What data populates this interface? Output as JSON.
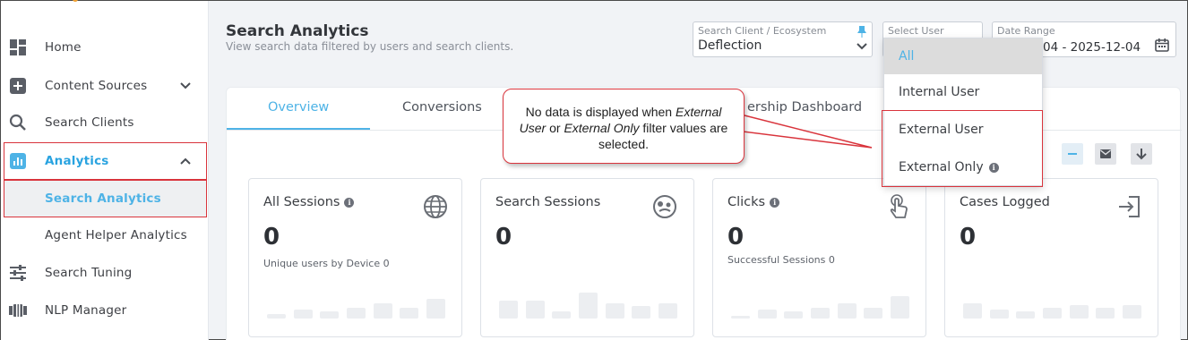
{
  "sidebar": {
    "items": [
      {
        "label": "Home",
        "icon": "dashboard-icon"
      },
      {
        "label": "Content Sources",
        "icon": "plus-box-icon"
      },
      {
        "label": "Search Clients",
        "icon": "search-icon"
      },
      {
        "label": "Analytics",
        "icon": "bar-chart-icon"
      },
      {
        "label": "Search Analytics"
      },
      {
        "label": "Agent Helper Analytics"
      },
      {
        "label": "Search Tuning",
        "icon": "sliders-icon"
      },
      {
        "label": "NLP Manager",
        "icon": "nlp-icon"
      }
    ]
  },
  "header": {
    "title": "Search Analytics",
    "subtitle": "View search data filtered by users and search clients."
  },
  "filters": {
    "client": {
      "label": "Search Client / Ecosystem",
      "value": "Deflection"
    },
    "user": {
      "label": "Select User"
    },
    "date": {
      "label": "Date Range",
      "value": "04 - 2025-12-04"
    }
  },
  "dropdown": {
    "options": [
      "All",
      "Internal User",
      "External User",
      "External Only"
    ],
    "selected": "All"
  },
  "tabs": [
    "Overview",
    "Conversions",
    "ership Dashboard"
  ],
  "cards": [
    {
      "title": "All Sessions",
      "value": "0",
      "sub": "Unique users by Device 0",
      "icon": "globe-icon",
      "bars": [
        0.15,
        0.3,
        0.25,
        0.35,
        0.5,
        0.35,
        0.65
      ]
    },
    {
      "title": "Search Sessions",
      "value": "0",
      "sub": "",
      "icon": "face-icon",
      "bars": [
        0.6,
        0.6,
        0.25,
        0.85,
        0.5,
        0.4,
        0.5
      ]
    },
    {
      "title": "Clicks",
      "value": "0",
      "sub": "Successful Sessions 0",
      "icon": "touch-icon",
      "bars": [
        0.1,
        0.3,
        0.25,
        0.35,
        0.5,
        0.35,
        0.75
      ]
    },
    {
      "title": "Cases Logged",
      "value": "0",
      "sub": "",
      "icon": "sign-in-icon",
      "bars": [
        0.5,
        0.3,
        0.25,
        0.35,
        0.45,
        0.35,
        0.45
      ]
    }
  ],
  "callout": {
    "line1_pre": "No data is displayed when ",
    "line1_em": "External",
    "line2_em1": "User",
    "line2_mid": " or ",
    "line2_em2": "External Only",
    "line2_post": " filter values are",
    "line3": "selected."
  },
  "colors": {
    "accent": "#4eb3e6",
    "highlight": "#d9343c"
  }
}
